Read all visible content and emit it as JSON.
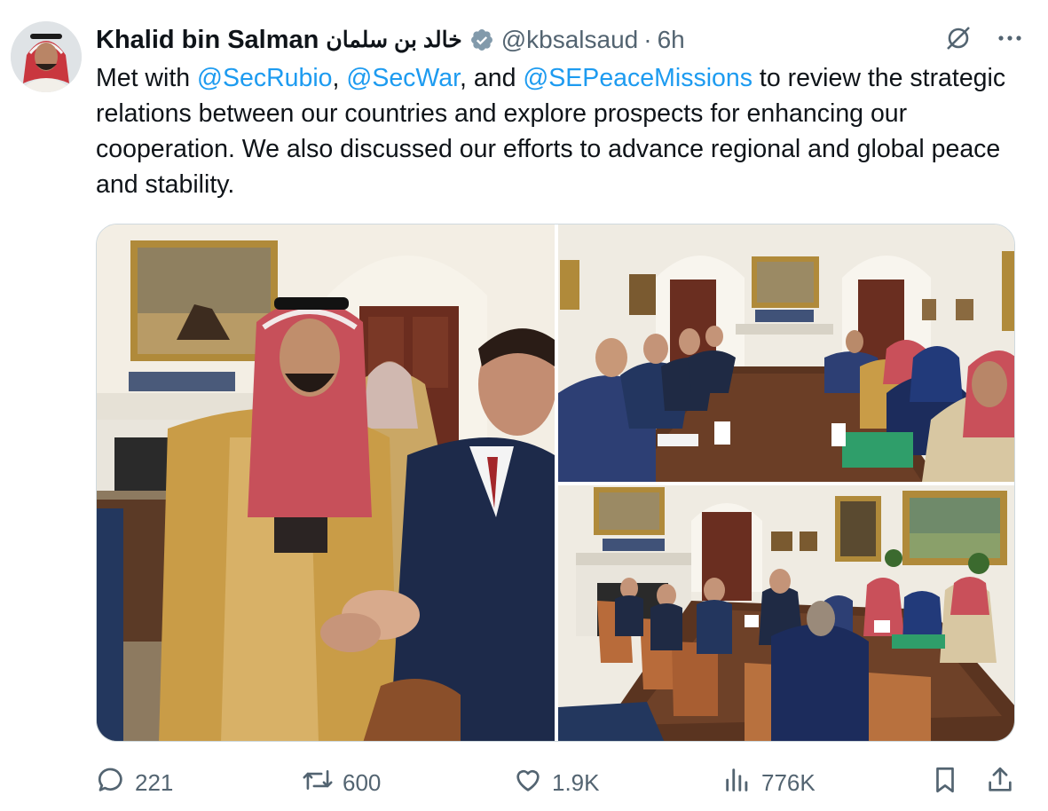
{
  "tweet": {
    "display_name": "Khalid bin Salman",
    "display_name_ar": "خالد بن سلمان",
    "handle": "@kbsalsaud",
    "separator": "·",
    "time": "6h",
    "text_1": "Met with ",
    "mention_1": "@SecRubio",
    "text_2": ", ",
    "mention_2": "@SecWar",
    "text_3": ", and ",
    "mention_3": "@SEPeaceMissions",
    "text_4": " to review the strategic relations between our countries and explore prospects for enhancing our cooperation. We also discussed our efforts to advance regional and global peace and stability."
  },
  "icons": {
    "verified": "verified-badge-icon",
    "grok": "grok-icon",
    "more": "more-icon",
    "reply": "reply-icon",
    "retweet": "retweet-icon",
    "like": "like-icon",
    "views": "views-icon",
    "bookmark": "bookmark-icon",
    "share": "share-icon"
  },
  "stats": {
    "replies": "221",
    "retweets": "600",
    "likes": "1.9K",
    "views": "776K"
  },
  "colors": {
    "link": "#1d9bf0",
    "muted": "#536471",
    "text": "#0f1419",
    "border": "#cfd9de"
  }
}
